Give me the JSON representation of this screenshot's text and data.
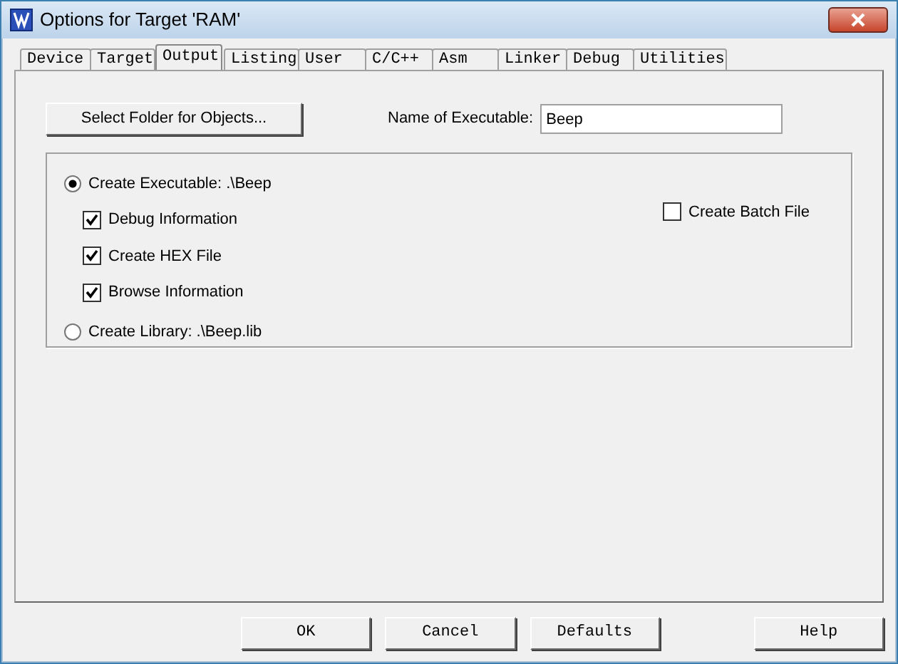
{
  "window": {
    "title": "Options for Target 'RAM'"
  },
  "tabs": [
    {
      "label": "Device",
      "selected": false
    },
    {
      "label": "Target",
      "selected": false
    },
    {
      "label": "Output",
      "selected": true
    },
    {
      "label": "Listing",
      "selected": false
    },
    {
      "label": "User",
      "selected": false
    },
    {
      "label": "C/C++",
      "selected": false
    },
    {
      "label": "Asm",
      "selected": false
    },
    {
      "label": "Linker",
      "selected": false
    },
    {
      "label": "Debug",
      "selected": false
    },
    {
      "label": "Utilities",
      "selected": false
    }
  ],
  "select_folder_button": "Select Folder for Objects...",
  "name_of_executable": {
    "label": "Name of Executable:",
    "value": "Beep"
  },
  "create_executable": {
    "label": "Create Executable:  .\\Beep",
    "selected": true
  },
  "options": [
    {
      "label": "Debug Information",
      "checked": true
    },
    {
      "label": "Create HEX File",
      "checked": true
    },
    {
      "label": "Browse Information",
      "checked": true
    }
  ],
  "create_library": {
    "label": "Create Library:  .\\Beep.lib",
    "selected": false
  },
  "create_batch_file": {
    "label": "Create Batch File",
    "checked": false
  },
  "buttons": [
    {
      "label": "OK"
    },
    {
      "label": "Cancel"
    },
    {
      "label": "Defaults"
    },
    {
      "label": "Help"
    }
  ]
}
